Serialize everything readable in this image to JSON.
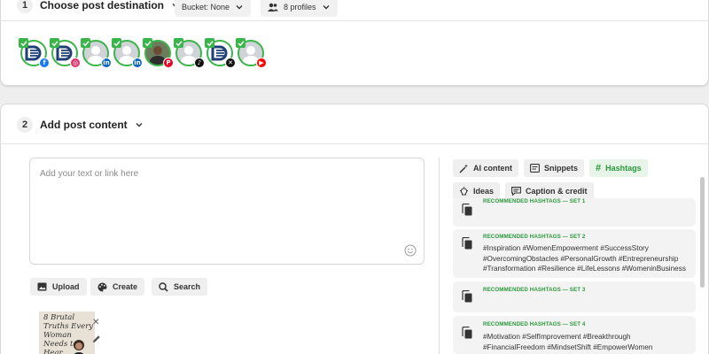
{
  "section1": {
    "step": "1",
    "title": "Choose post destination",
    "bucket_label": "Bucket: None",
    "profiles_label": "8 profiles"
  },
  "profiles": [
    {
      "type": "brand",
      "network": "facebook",
      "color": "#1877f2"
    },
    {
      "type": "brand",
      "network": "instagram",
      "color": "#e1306c"
    },
    {
      "type": "person",
      "network": "linkedin",
      "color": "#0a66c2"
    },
    {
      "type": "person",
      "network": "linkedin",
      "color": "#0a66c2"
    },
    {
      "type": "photo",
      "network": "pinterest",
      "color": "#e60023"
    },
    {
      "type": "person",
      "network": "tiktok",
      "color": "#111111"
    },
    {
      "type": "brand",
      "network": "x",
      "color": "#111111"
    },
    {
      "type": "person",
      "network": "youtube",
      "color": "#ff0000"
    }
  ],
  "section2": {
    "step": "2",
    "title": "Add post content"
  },
  "composer": {
    "placeholder": "Add your text or link here",
    "upload_label": "Upload",
    "create_label": "Create",
    "search_label": "Search"
  },
  "media": {
    "thumb_text": "8 Brutal Truths Every Woman Needs to Hear"
  },
  "right_tabs": {
    "ai_content": "AI content",
    "snippets": "Snippets",
    "hashtags": "Hashtags",
    "ideas": "Ideas",
    "caption_credit": "Caption & credit"
  },
  "hashtag_sets": [
    {
      "label": "RECOMMENDED HASHTAGS — SET 1",
      "tags": ""
    },
    {
      "label": "RECOMMENDED HASHTAGS — SET 2",
      "tags": "#Inspiration #WomenEmpowerment #SuccessStory #OvercomingObstacles #PersonalGrowth #Entrepreneurship #Transformation #Resilience #LifeLessons #WomeninBusiness"
    },
    {
      "label": "RECOMMENDED HASHTAGS — SET 3",
      "tags": ""
    },
    {
      "label": "RECOMMENDED HASHTAGS — SET 4",
      "tags": "#Motivation #SelfImprovement #Breakthrough #FinancialFreedom #MindsetShift #EmpowerWomen"
    }
  ],
  "colors": {
    "accent_green": "#3ab54a",
    "hashtag_green": "#2a9a3b"
  }
}
